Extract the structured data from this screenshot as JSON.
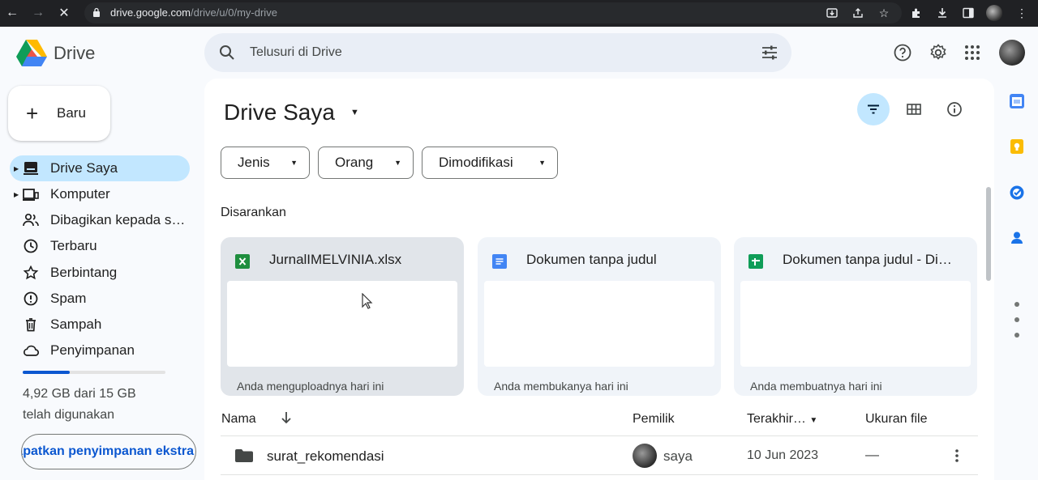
{
  "browser": {
    "url_host": "drive.google.com",
    "url_path": "/drive/u/0/my-drive",
    "icons": [
      "back-icon",
      "forward-icon",
      "stop-loading-icon",
      "lock-icon",
      "install-app-icon",
      "share-icon",
      "bookmark-star-icon",
      "extensions-icon",
      "downloads-icon",
      "side-panel-icon",
      "profile-icon",
      "more-vert-icon"
    ]
  },
  "header": {
    "app_name": "Drive",
    "search_placeholder": "Telusuri di Drive"
  },
  "sidebar": {
    "new_label": "Baru",
    "items": [
      {
        "label": "Drive Saya",
        "icon": "my-drive-icon",
        "active": true
      },
      {
        "label": "Komputer",
        "icon": "computer-icon"
      },
      {
        "label": "Dibagikan kepada saya",
        "icon": "shared-icon"
      },
      {
        "label": "Terbaru",
        "icon": "clock-icon"
      },
      {
        "label": "Berbintang",
        "icon": "star-icon"
      },
      {
        "label": "Spam",
        "icon": "spam-icon"
      },
      {
        "label": "Sampah",
        "icon": "trash-icon"
      },
      {
        "label": "Penyimpanan",
        "icon": "cloud-icon"
      }
    ],
    "storage": {
      "used_fraction": 0.33,
      "line1": "4,92 GB dari 15 GB",
      "line2": "telah digunakan",
      "button": "Dapatkan penyimpanan ekstra"
    }
  },
  "main": {
    "title": "Drive Saya",
    "filters": [
      "Jenis",
      "Orang",
      "Dimodifikasi"
    ],
    "suggested_label": "Disarankan",
    "cards": [
      {
        "name": "JurnalIMELVINIA.xlsx",
        "type": "excel",
        "subtitle": "Anda menguploadnya hari ini"
      },
      {
        "name": "Dokumen tanpa judul",
        "type": "docs",
        "subtitle": "Anda membukanya hari ini"
      },
      {
        "name": "Dokumen tanpa judul - Di…",
        "type": "sheets",
        "subtitle": "Anda membuatnya hari ini"
      }
    ],
    "columns": {
      "name": "Nama",
      "owner": "Pemilik",
      "modified": "Terakhir…",
      "size": "Ukuran file"
    },
    "rows": [
      {
        "name": "surat_rekomendasi",
        "owner": "saya",
        "modified": "10 Jun 2023",
        "size": "—"
      }
    ]
  },
  "colors": {
    "accent": "#0b57d0",
    "active_nav": "#c2e7ff",
    "chrome": "#202124",
    "excel": "#1e8e3e",
    "docs": "#4285f4",
    "sheets": "#0f9d58"
  }
}
